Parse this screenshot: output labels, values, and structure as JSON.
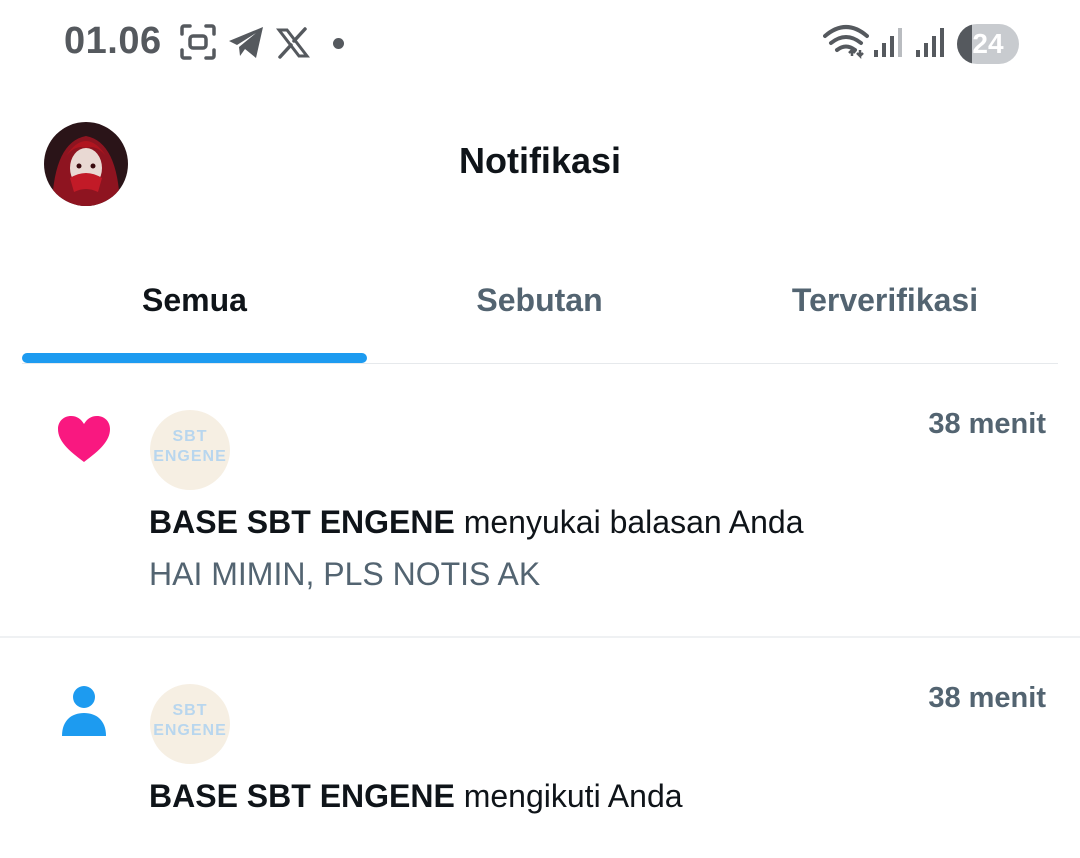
{
  "status_bar": {
    "time": "01.06",
    "battery_level": "24",
    "battery_fraction": 0.24,
    "icons": [
      "screenshot-icon",
      "telegram-icon",
      "x-logo-icon",
      "notification-dot",
      "wifi-icon",
      "signal-icon",
      "signal-icon",
      "battery-icon"
    ]
  },
  "header": {
    "title": "Notifikasi"
  },
  "tabs": [
    {
      "label": "Semua",
      "active": true
    },
    {
      "label": "Sebutan",
      "active": false
    },
    {
      "label": "Terverifikasi",
      "active": false
    }
  ],
  "notifications": [
    {
      "type_icon": "heart-icon",
      "avatar_text": [
        "SBT",
        "ENGENE"
      ],
      "time": "38 menit",
      "actor": "BASE SBT ENGENE",
      "action": " menyukai balasan Anda",
      "snippet": "HAI MIMIN, PLS NOTIS AK"
    },
    {
      "type_icon": "person-icon",
      "avatar_text": [
        "SBT",
        "ENGENE"
      ],
      "time": "38 menit",
      "actor": "BASE SBT ENGENE",
      "action": " mengikuti Anda"
    }
  ],
  "colors": {
    "accent": "#1d9bf0",
    "heart": "#f91880",
    "text_primary": "#0f1419",
    "text_secondary": "#536471"
  }
}
